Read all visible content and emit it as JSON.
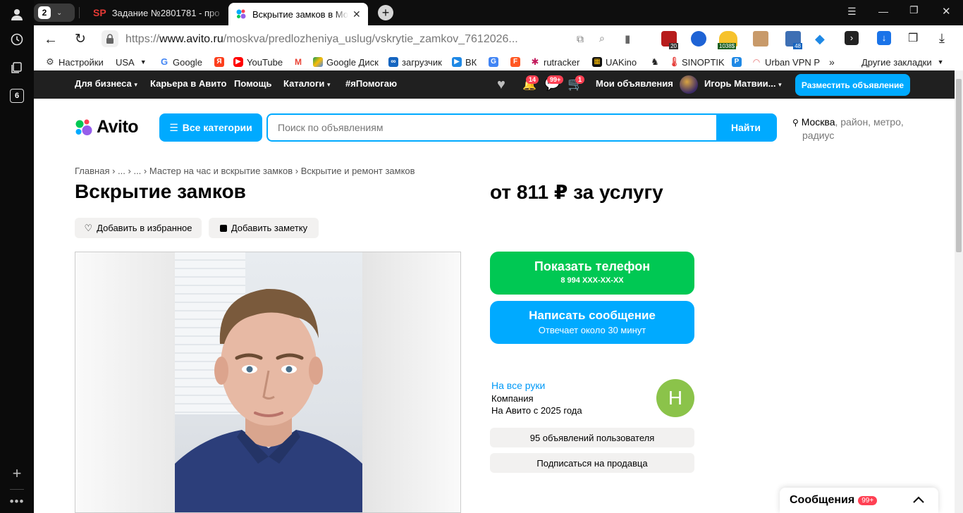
{
  "browser": {
    "tab_count": "2",
    "tabs": [
      {
        "favicon_text": "SP",
        "title": "Задание №2801781 - про"
      },
      {
        "title": "Вскрытие замков в Мо"
      }
    ],
    "url": {
      "prefix": "https://",
      "domain": "www.avito.ru",
      "path": "/moskva/predlozheniya_uslug/vskrytie_zamkov_7612026..."
    },
    "extension_badges": [
      "20",
      "1038$",
      "48"
    ],
    "bookmarks": [
      "Настройки",
      "USA",
      "Google",
      "YouTube",
      "Google Диск",
      "загрузчик",
      "ВК",
      "rutracker",
      "UAKino",
      "SINOPTIK",
      "Urban VPN P"
    ],
    "bookmarks_more": "»",
    "other_bookmarks": "Другие закладки",
    "rail_badge": "6"
  },
  "avito_top": {
    "links": [
      "Для бизнеса",
      "Карьера в Авито",
      "Помощь",
      "Каталоги",
      "#яПомогаю"
    ],
    "notif_badge": "14",
    "msg_badge": "99+",
    "cart_badge": "1",
    "my_ads": "Мои объявления",
    "user_name": "Игорь Матвии...",
    "post_button": "Разместить объявление"
  },
  "search": {
    "logo": "Avito",
    "categories_button": "Все категории",
    "placeholder": "Поиск по объявлениям",
    "find_button": "Найти",
    "location_city": "Москва",
    "location_rest": ", район, метро,",
    "location_line2": "радиус"
  },
  "listing": {
    "breadcrumb": [
      "Главная",
      "...",
      "...",
      "Мастер на час и вскрытие замков",
      "Вскрытие и ремонт замков"
    ],
    "title": "Вскрытие замков",
    "price": "от 811 ₽ за услугу",
    "add_favorite": "Добавить в избранное",
    "add_note": "Добавить заметку",
    "show_phone": "Показать телефон",
    "phone_masked": "8 994 XXX-XX-XX",
    "write_message": "Написать сообщение",
    "response_time": "Отвечает около 30 минут"
  },
  "seller": {
    "name": "На все руки",
    "type": "Компания",
    "since": "На Авито с 2025 года",
    "avatar_letter": "Н",
    "ads_count": "95 объявлений пользователя",
    "subscribe": "Подписаться на продавца"
  },
  "messenger": {
    "label": "Сообщения",
    "badge": "99+"
  },
  "colors": {
    "green": "#00c853",
    "blue": "#00aaff",
    "dark_bar": "#202020",
    "avatar": "#8bc34a"
  }
}
